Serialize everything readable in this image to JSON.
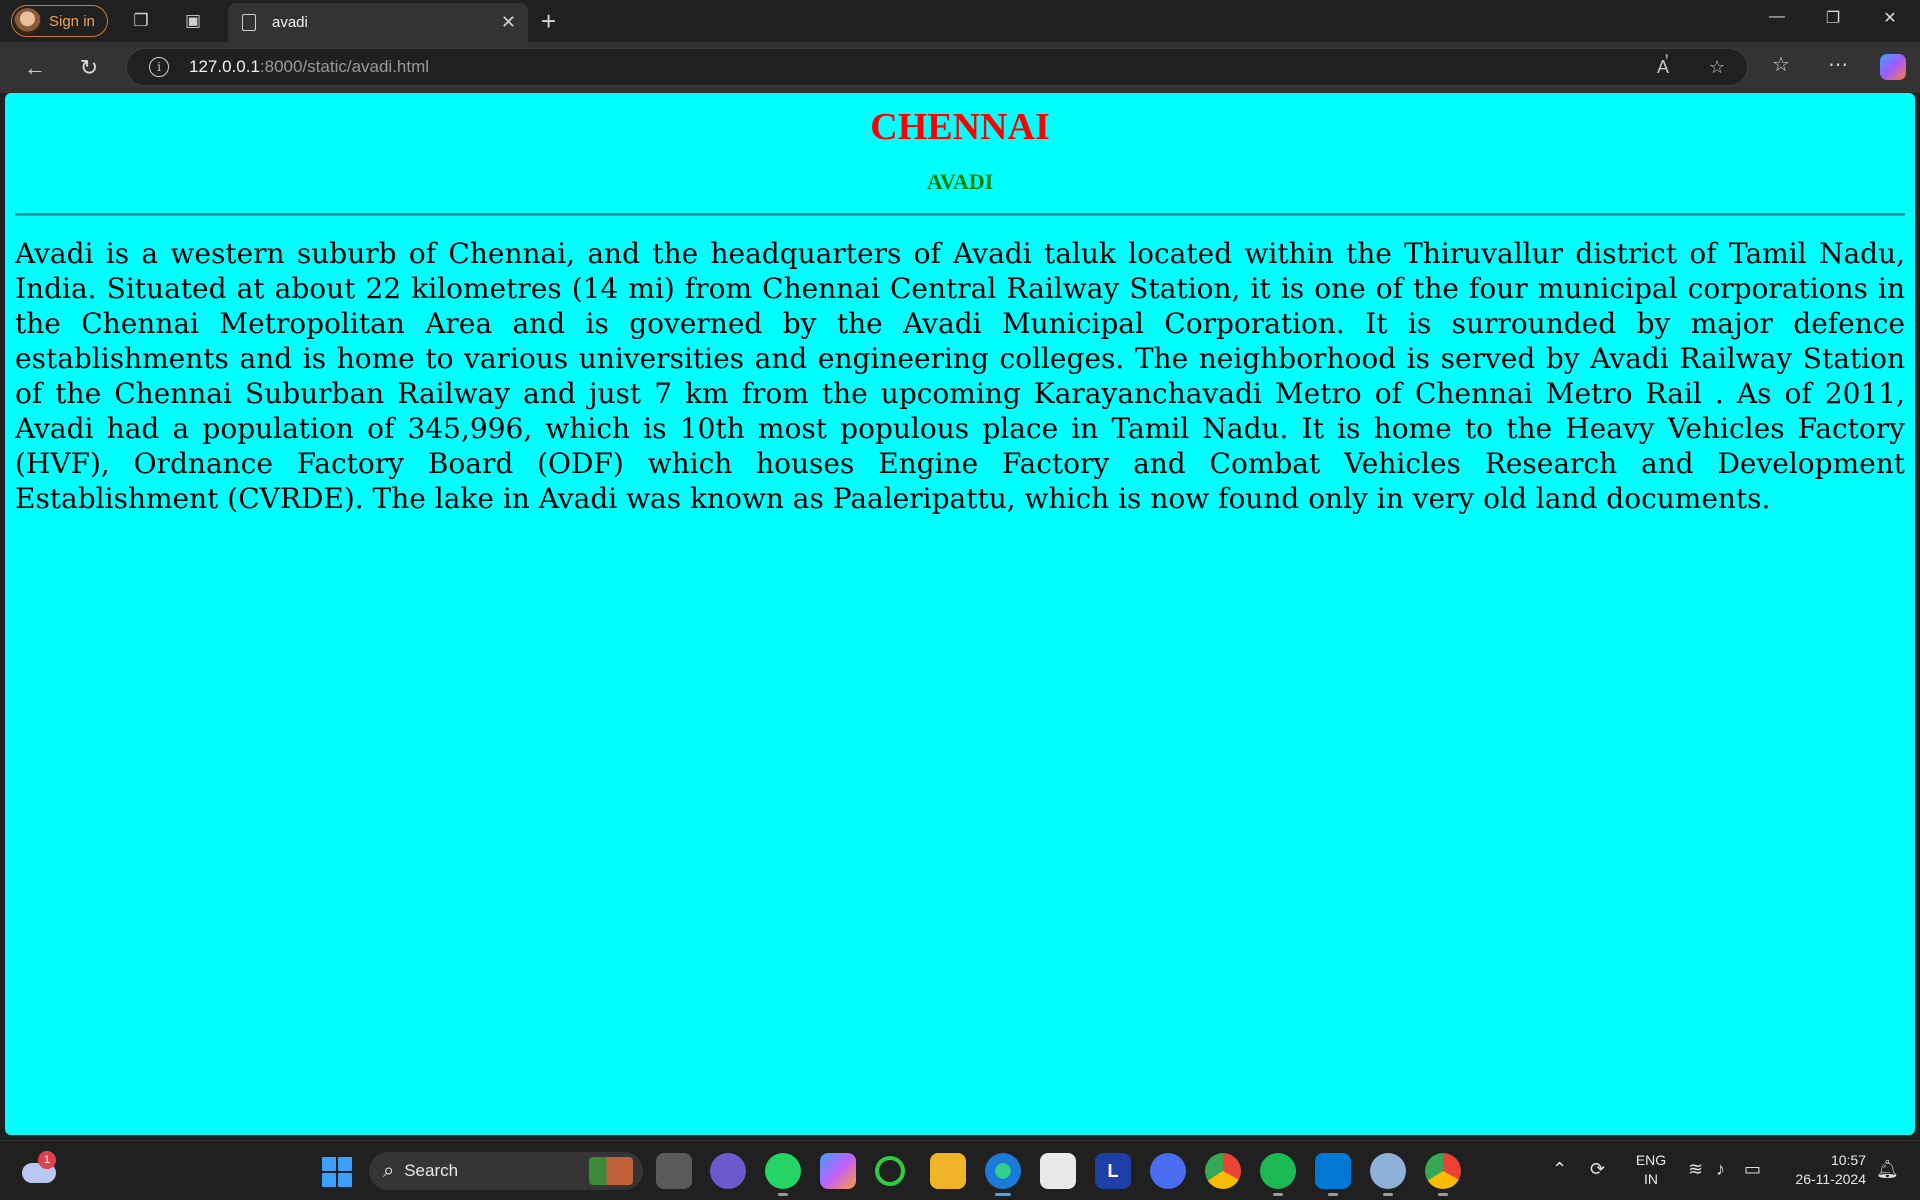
{
  "browser": {
    "signin_label": "Sign in",
    "tab_title": "avadi",
    "url_host": "127.0.0.1",
    "url_rest": ":8000/static/avadi.html"
  },
  "page": {
    "title": "CHENNAI",
    "subtitle": "AVADI",
    "paragraph": "Avadi is a western suburb of Chennai, and the headquarters of Avadi taluk located within the Thiruvallur district of Tamil Nadu, India. Situated at about 22 kilometres (14 mi) from Chennai Central Railway Station, it is one of the four municipal corporations in the Chennai Metropolitan Area and is governed by the Avadi Municipal Corporation. It is surrounded by major defence establishments and is home to various universities and engineering colleges. The neighborhood is served by Avadi Railway Station of the Chennai Suburban Railway and just 7 km from the upcoming Karayanchavadi Metro of Chennai Metro Rail . As of 2011, Avadi had a population of 345,996, which is 10th most populous place in Tamil Nadu. It is home to the Heavy Vehicles Factory (HVF), Ordnance Factory Board (ODF) which houses Engine Factory and Combat Vehicles Research and Development Establishment (CVRDE). The lake in Avadi was known as Paaleripattu, which is now found only in very old land documents.",
    "colors": {
      "background": "#00ffff",
      "title": "#ff0000",
      "subtitle": "#008000"
    }
  },
  "taskbar": {
    "weather_badge": "1",
    "search_label": "Search",
    "lang_top": "ENG",
    "lang_bottom": "IN",
    "time": "10:57",
    "date": "26-11-2024",
    "apps": [
      "task-view",
      "chat",
      "whatsapp",
      "copilot",
      "spinner",
      "file-explorer",
      "edge",
      "store",
      "l-app",
      "vector-app",
      "chrome",
      "spotify",
      "vscode",
      "network-app",
      "chrome-profile"
    ]
  }
}
